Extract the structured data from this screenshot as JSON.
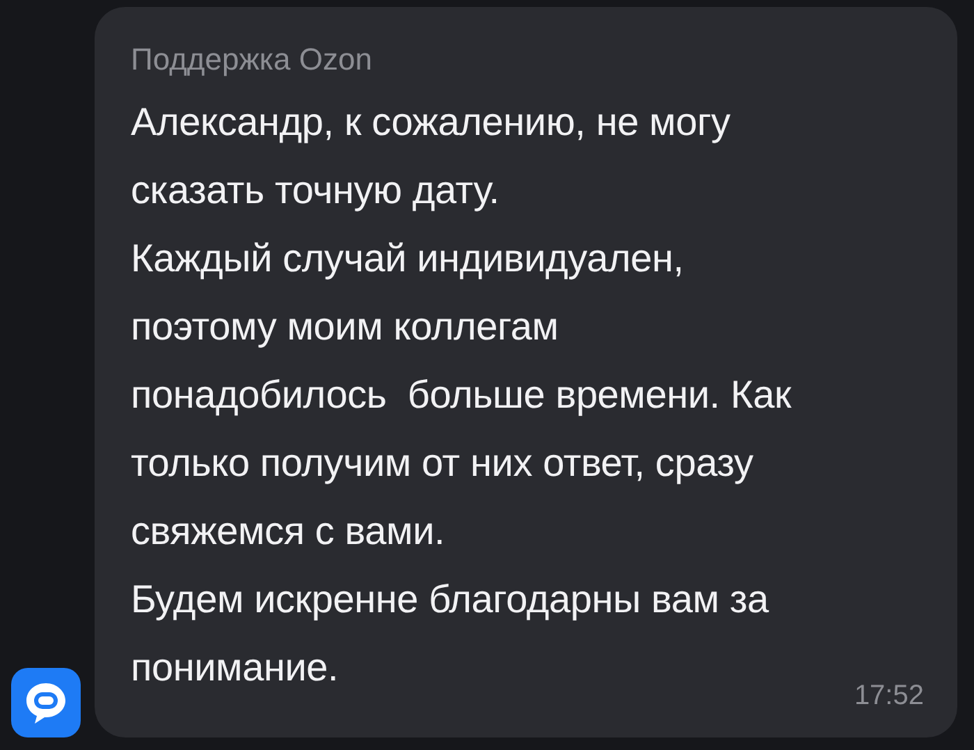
{
  "message": {
    "sender": "Поддержка Ozon",
    "paragraphs": [
      [
        "Александр, к сожалению, не могу",
        "сказать точную дату."
      ],
      [
        "Каждый случай индивидуален,",
        "поэтому моим коллегам",
        "понадобилось  больше времени. Как",
        "только получим от них ответ, сразу",
        "свяжемся с вами."
      ],
      [
        "Будем искренне благодарны вам за",
        "понимание."
      ]
    ],
    "time": "17:52"
  }
}
